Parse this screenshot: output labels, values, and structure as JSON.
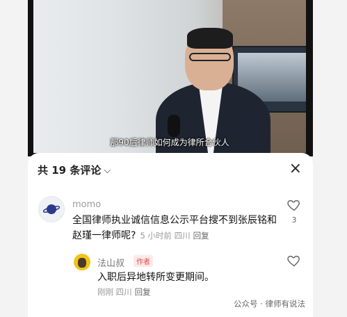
{
  "video": {
    "subtitle": "那90后律师如何成为律所合伙人"
  },
  "comments_panel": {
    "title": "共 19 条评论",
    "chevron_icon": "chevron-down-icon",
    "close_icon": "×"
  },
  "comments": [
    {
      "username": "momo",
      "text": "全国律师执业诚信信息公示平台搜不到张辰铭和赵瑾一律师呢?",
      "time": "5 小时前",
      "location": "四川",
      "reply_label": "回复",
      "like_count": "3"
    }
  ],
  "reply": {
    "username": "法山叔",
    "badge": "作者",
    "text": "入职后异地转所变更期间。",
    "time": "刚刚",
    "location": "四川",
    "reply_label": "回复"
  },
  "watermark": "公众号 · 律师有说法"
}
